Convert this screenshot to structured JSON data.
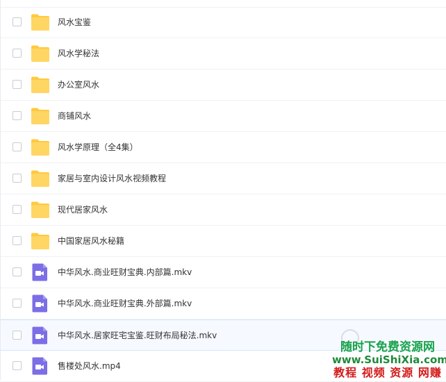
{
  "files": [
    {
      "name": "风水宝鉴",
      "type": "folder"
    },
    {
      "name": "风水学秘法",
      "type": "folder"
    },
    {
      "name": "办公室风水",
      "type": "folder"
    },
    {
      "name": "商铺风水",
      "type": "folder"
    },
    {
      "name": "风水学原理（全4集）",
      "type": "folder"
    },
    {
      "name": "家居与室内设计风水视频教程",
      "type": "folder"
    },
    {
      "name": "现代居家风水",
      "type": "folder"
    },
    {
      "name": "中国家居风水秘籍",
      "type": "folder"
    },
    {
      "name": "中华风水.商业旺财宝典.内部篇.mkv",
      "type": "video"
    },
    {
      "name": "中华风水.商业旺财宝典.外部篇.mkv",
      "type": "video"
    },
    {
      "name": "中华风水.居家旺宅宝鉴.旺财布局秘法.mkv",
      "type": "video"
    },
    {
      "name": "售楼处风水.mp4",
      "type": "video"
    }
  ],
  "watermark": {
    "line1": "随时下免费资源网",
    "line2": "www.SuiShiXia.com",
    "line3": "教程 视频 资源 网赚"
  },
  "colors": {
    "folder": "#ffc93f",
    "video": "#7b6ee6",
    "hover_row": "#f6f9ff"
  }
}
